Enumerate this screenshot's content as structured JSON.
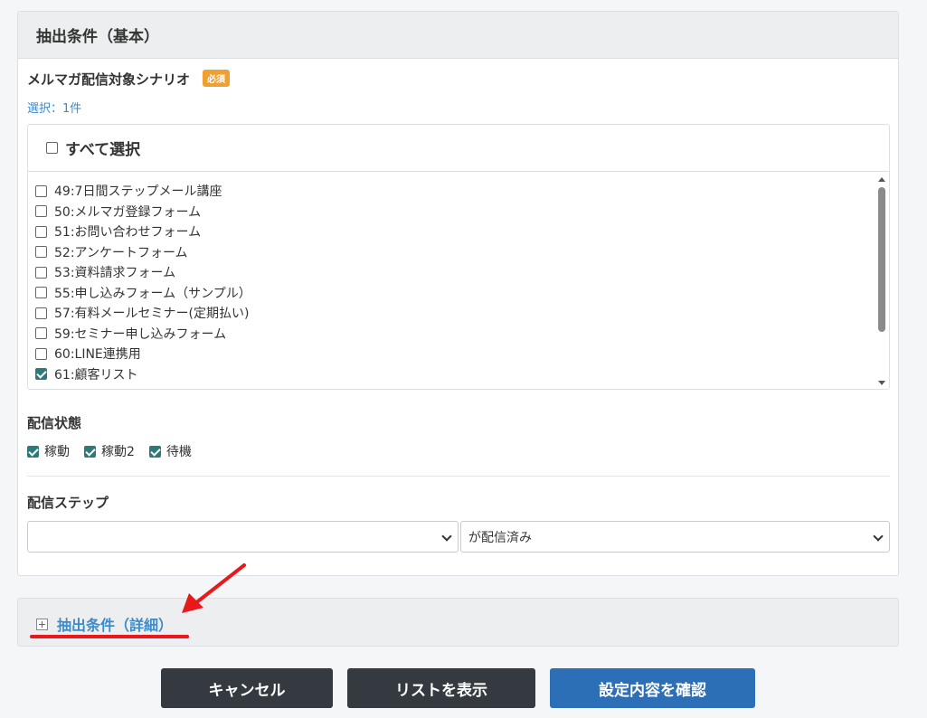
{
  "basic_panel": {
    "title": "抽出条件（基本）",
    "scenario_label": "メルマガ配信対象シナリオ",
    "required_badge": "必須",
    "selected_count": "選択：1件",
    "select_all_label": "すべて選択",
    "scenarios": [
      {
        "label": "49:7日間ステップメール講座",
        "checked": false
      },
      {
        "label": "50:メルマガ登録フォーム",
        "checked": false
      },
      {
        "label": "51:お問い合わせフォーム",
        "checked": false
      },
      {
        "label": "52:アンケートフォーム",
        "checked": false
      },
      {
        "label": "53:資料請求フォーム",
        "checked": false
      },
      {
        "label": "55:申し込みフォーム（サンプル）",
        "checked": false
      },
      {
        "label": "57:有料メールセミナー(定期払い)",
        "checked": false
      },
      {
        "label": "59:セミナー申し込みフォーム",
        "checked": false
      },
      {
        "label": "60:LINE連携用",
        "checked": false
      },
      {
        "label": "61:顧客リスト",
        "checked": true
      }
    ],
    "status_label": "配信状態",
    "status_options": [
      {
        "label": "稼動",
        "checked": true
      },
      {
        "label": "稼動2",
        "checked": true
      },
      {
        "label": "待機",
        "checked": true
      }
    ],
    "step_label": "配信ステップ",
    "step_select_value": "",
    "step_condition_value": "が配信済み"
  },
  "detail_panel": {
    "title": "抽出条件（詳細）"
  },
  "buttons": {
    "cancel": "キャンセル",
    "show_list": "リストを表示",
    "confirm": "設定内容を確認"
  },
  "colors": {
    "accent_blue": "#3d8bc9",
    "primary_button": "#2d6fb7",
    "dark_button": "#343a40",
    "required_badge": "#f0a030",
    "annotation_red": "#e8181b",
    "checkbox_checked": "#2c7a7b"
  }
}
